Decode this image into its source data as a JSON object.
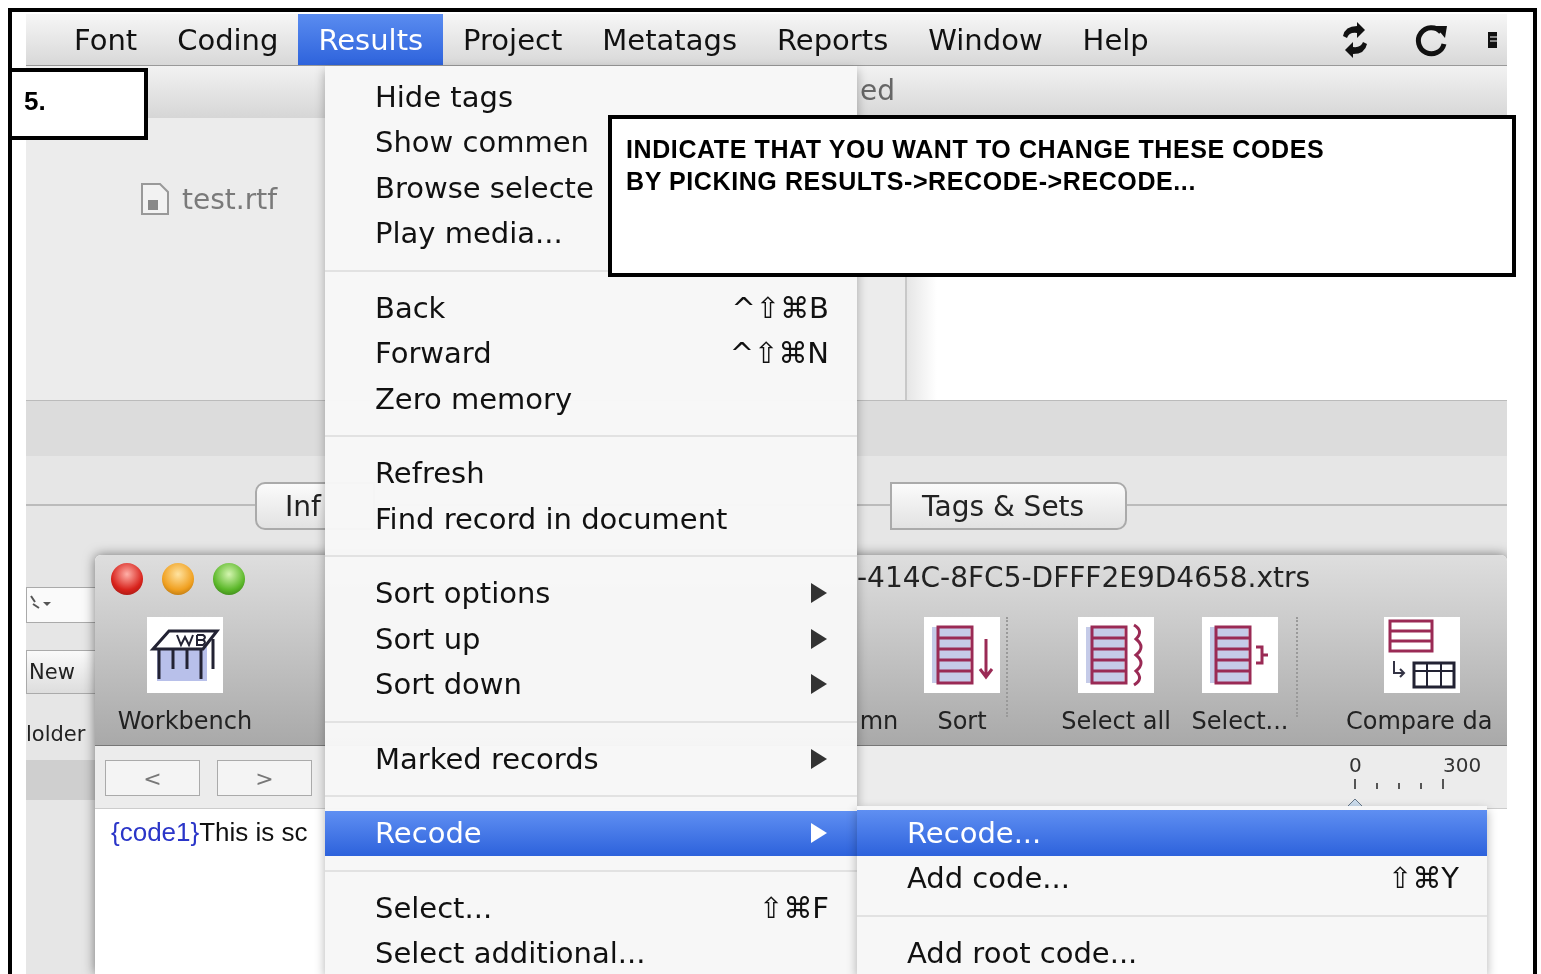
{
  "menubar": {
    "items": [
      {
        "label": "Font",
        "selected": false
      },
      {
        "label": "Coding",
        "selected": false
      },
      {
        "label": "Results",
        "selected": true
      },
      {
        "label": "Project",
        "selected": false
      },
      {
        "label": "Metatags",
        "selected": false
      },
      {
        "label": "Reports",
        "selected": false
      },
      {
        "label": "Window",
        "selected": false
      },
      {
        "label": "Help",
        "selected": false
      }
    ]
  },
  "main_window": {
    "header_text": "ed",
    "file": "test.rtf",
    "tabs": [
      "Inf",
      "Tags & Sets"
    ],
    "sidebar_button": "New",
    "sidebar_label": "lolder"
  },
  "document_window": {
    "title": "-414C-8FC5-DFFF2E9D4658.xtrs",
    "toolbar": [
      {
        "label": "Workbench",
        "kind": "workbench"
      },
      {
        "label": "mn",
        "kind": "hidden"
      },
      {
        "label": "Sort",
        "kind": "sort"
      },
      {
        "label": "Select all",
        "kind": "select-all"
      },
      {
        "label": "Select...",
        "kind": "select"
      },
      {
        "label": "Compare da",
        "kind": "compare"
      }
    ],
    "nav": [
      "<",
      ">"
    ],
    "ruler_labels": [
      "0",
      "300"
    ],
    "code": "{code1}",
    "text": "This is sc"
  },
  "menu": {
    "groups": [
      [
        {
          "label": "Hide tags",
          "submenu": false,
          "selected": false
        },
        {
          "label": "Show commen",
          "selected": false
        },
        {
          "label": "Browse selecte",
          "selected": false
        },
        {
          "label": "Play media...",
          "selected": false
        }
      ],
      [
        {
          "label": "Back",
          "shortcut": "^⇧⌘B",
          "submenu": false,
          "selected": false
        },
        {
          "label": "Forward",
          "shortcut": "^⇧⌘N",
          "submenu": false,
          "selected": false
        },
        {
          "label": "Zero memory",
          "submenu": false,
          "selected": false
        }
      ],
      [
        {
          "label": "Refresh",
          "submenu": false,
          "selected": false
        },
        {
          "label": "Find record in document",
          "submenu": false,
          "selected": false
        }
      ],
      [
        {
          "label": "Sort options",
          "submenu": true,
          "selected": false
        },
        {
          "label": "Sort up",
          "submenu": true,
          "selected": false
        },
        {
          "label": "Sort down",
          "submenu": true,
          "selected": false
        }
      ],
      [
        {
          "label": "Marked records",
          "submenu": true,
          "selected": false
        }
      ],
      [
        {
          "label": "Recode",
          "submenu": true,
          "selected": true
        }
      ],
      [
        {
          "label": "Select...",
          "shortcut": "⇧⌘F",
          "submenu": false,
          "selected": false
        },
        {
          "label": "Select additional...",
          "submenu": false,
          "selected": false
        }
      ]
    ]
  },
  "submenu": {
    "groups": [
      [
        {
          "label": "Recode...",
          "submenu": false,
          "selected": true
        },
        {
          "label": "Add code...",
          "shortcut": "⇧⌘Y",
          "submenu": false,
          "selected": false
        }
      ],
      [
        {
          "label": "Add root code...",
          "submenu": false,
          "selected": false
        }
      ]
    ]
  },
  "callouts": {
    "step": "5.",
    "instruction": "INDICATE THAT YOU WANT TO CHANGE THESE CODES\nBY PICKING RESULTS->RECODE->RECODE..."
  }
}
